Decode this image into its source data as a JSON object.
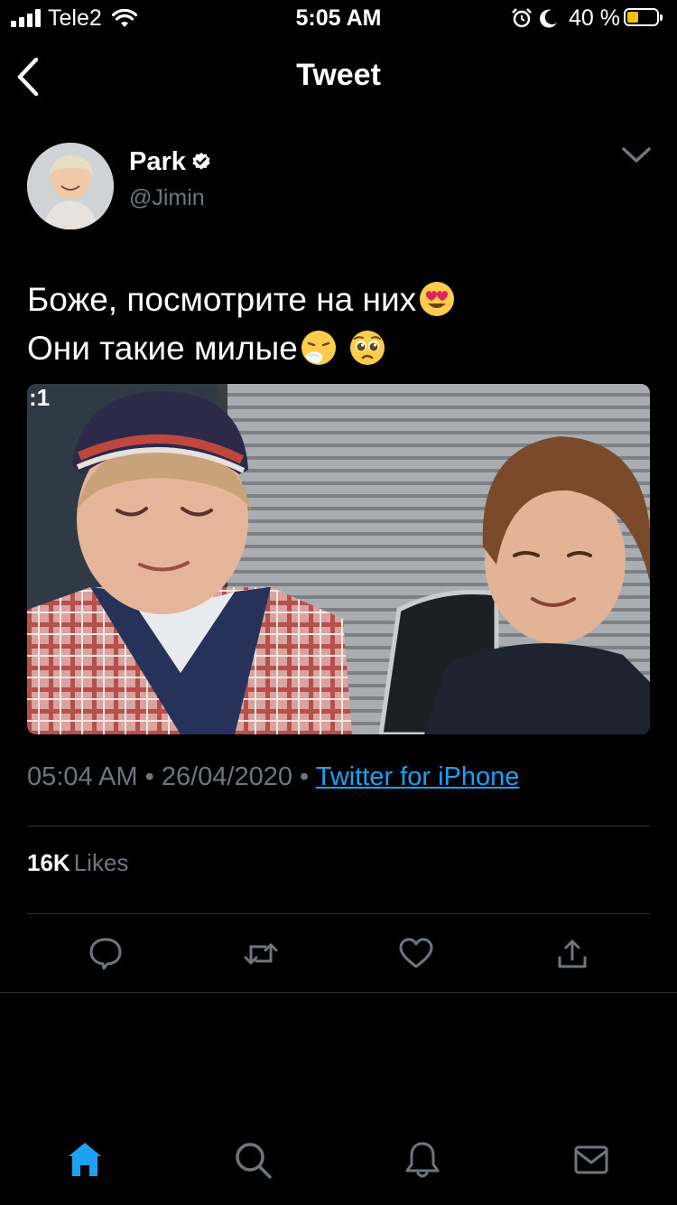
{
  "status_bar": {
    "carrier": "Tele2",
    "time": "5:05 AM",
    "battery_percent": "40 %",
    "battery_level": 0.4,
    "battery_color": "#f4c20d"
  },
  "header": {
    "title": "Tweet",
    "back_icon": "chevron-left-icon"
  },
  "author": {
    "name": "Park",
    "handle": "@Jimin",
    "verified": true
  },
  "tweet": {
    "line1": "Боже, посмотрите на них",
    "line1_emoji": "heart-eyes-emoji",
    "line2": "Они такие милые",
    "line2_emojis": [
      "sneezing-face-emoji",
      "pleading-face-emoji"
    ],
    "time": "05:04 AM",
    "date": "26/04/2020",
    "source": "Twitter for iPhone",
    "source_color": "#1da1f2"
  },
  "stats": {
    "likes_count": "16K",
    "likes_label": "Likes"
  },
  "actions": [
    "reply-icon",
    "retweet-icon",
    "like-icon",
    "share-icon"
  ],
  "tab_bar": {
    "items": [
      "home-icon",
      "search-icon",
      "notifications-icon",
      "messages-icon"
    ],
    "active": "home-icon",
    "accent_color": "#1da1f2"
  },
  "colors": {
    "background": "#000000",
    "text": "#ffffff",
    "secondary_text": "#6e767d",
    "divider": "#2f3336"
  }
}
